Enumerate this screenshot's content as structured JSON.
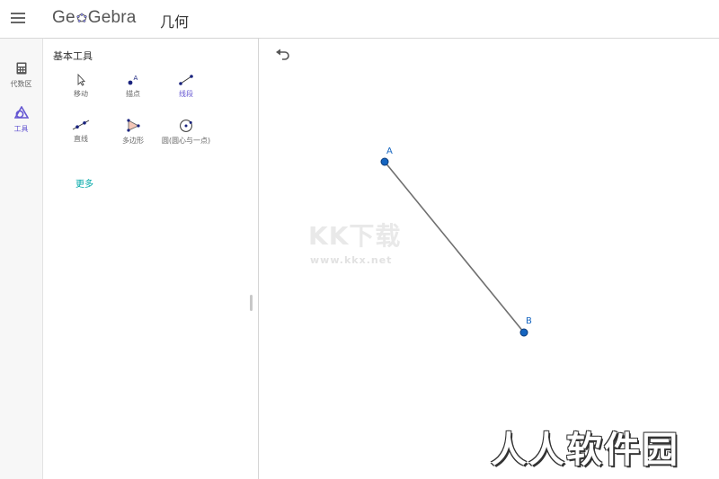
{
  "header": {
    "logo_text_pre": "Ge",
    "logo_text_post": "Gebra",
    "app_title": "几何"
  },
  "left_rail": {
    "items": [
      {
        "label": "代数区",
        "icon": "calculator-icon"
      },
      {
        "label": "工具",
        "icon": "tools-icon",
        "active": true
      }
    ]
  },
  "tools_panel": {
    "title": "基本工具",
    "tools": [
      {
        "label": "移动",
        "icon": "move-cursor-icon"
      },
      {
        "label": "描点",
        "icon": "point-icon"
      },
      {
        "label": "线段",
        "icon": "segment-icon",
        "active": true
      },
      {
        "label": "直线",
        "icon": "line-icon"
      },
      {
        "label": "多边形",
        "icon": "polygon-icon"
      },
      {
        "label": "圆(圆心与一点)",
        "icon": "circle-center-point-icon"
      }
    ],
    "more_label": "更多"
  },
  "canvas": {
    "points": [
      {
        "name": "A"
      },
      {
        "name": "B"
      }
    ],
    "segment": {
      "from": "A",
      "to": "B"
    },
    "point_color": "#1565c0",
    "segment_color": "#707070"
  },
  "watermarks": {
    "site_logo": "KK下载",
    "site_url": "www.kkx.net",
    "corner_text": "人人软件园"
  },
  "colors": {
    "accent": "#6557d2",
    "more_link": "#00a8a8"
  }
}
